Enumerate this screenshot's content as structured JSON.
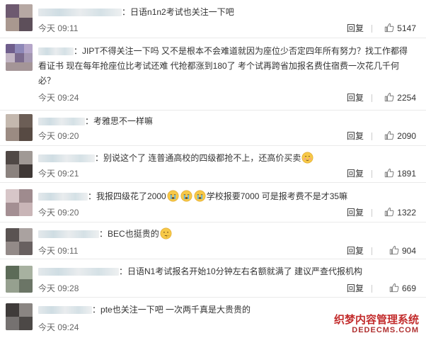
{
  "comments": [
    {
      "text": "日语n1n2考试也关注一下吧",
      "time": "今天 09:11",
      "reply_label": "回复",
      "likes": "5147"
    },
    {
      "text": "JIPT不得关注一下吗 又不是根本不会难道就因为座位少否定四年所有努力？找工作都得看证书 现在每年抢座位比考试还难 代抢都涨到180了 考个试再跨省加报名费住宿费一次花几千何必？",
      "time": "今天 09:24",
      "reply_label": "回复",
      "likes": "2254"
    },
    {
      "text": "考雅思不一样嘛",
      "time": "今天 09:20",
      "reply_label": "回复",
      "likes": "2090"
    },
    {
      "text_before": "别说这个了 连普通高校的四级都抢不上，还高价买卖",
      "time": "今天 09:21",
      "reply_label": "回复",
      "likes": "1891"
    },
    {
      "text_before": "我报四级花了2000",
      "text_after": "学校报要7000 可是报考费不是才35嘛",
      "time": "今天 09:20",
      "reply_label": "回复",
      "likes": "1322"
    },
    {
      "text_before": "BEC也挺贵的",
      "time": "今天 09:11",
      "reply_label": "回复",
      "likes": "904"
    },
    {
      "text": "日语N1考试报名开始10分钟左右名额就满了 建议严查代报机构",
      "time": "今天 09:28",
      "reply_label": "回复",
      "likes": "669"
    },
    {
      "text": "pte也关注一下吧 一次两千真是大贵贵的",
      "time": "今天 09:24",
      "reply_label": "",
      "likes": ""
    }
  ],
  "watermark": {
    "line1": "织梦内容管理系统",
    "line2": "DEDECMS.COM"
  },
  "colors": {
    "text": "#333333",
    "meta": "#666666",
    "divider": "#eaeaea",
    "watermark": "#c32d2d"
  }
}
